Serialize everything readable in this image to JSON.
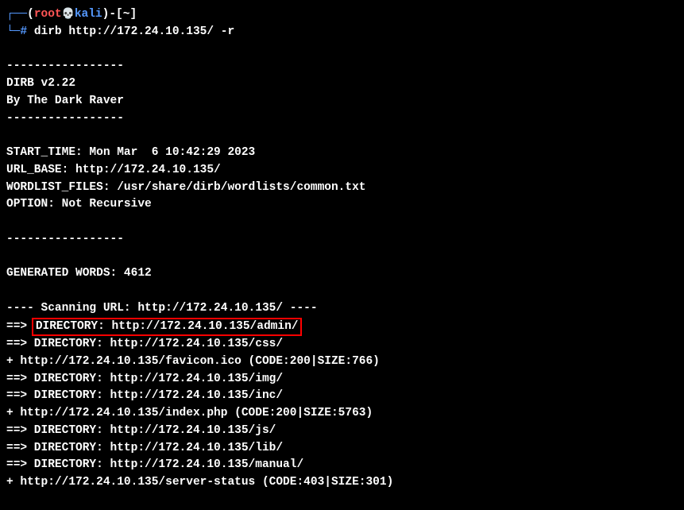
{
  "prompt": {
    "open_paren": "(",
    "user": "root",
    "skull": "💀",
    "host": "kali",
    "close_paren": ")",
    "dash": "-",
    "open_bracket": "[",
    "path": "~",
    "close_bracket": "]",
    "hash": "#",
    "corner_top": "┌──",
    "corner_bottom": "└─"
  },
  "command": "dirb http://172.24.10.135/ -r",
  "output": {
    "sep1": "-----------------",
    "version": "DIRB v2.22",
    "author": "By The Dark Raver",
    "sep2": "-----------------",
    "start_time": "START_TIME: Mon Mar  6 10:42:29 2023",
    "url_base": "URL_BASE: http://172.24.10.135/",
    "wordlist": "WORDLIST_FILES: /usr/share/dirb/wordlists/common.txt",
    "option": "OPTION: Not Recursive",
    "sep3": "-----------------",
    "generated": "GENERATED WORDS: 4612",
    "scanning": "---- Scanning URL: http://172.24.10.135/ ----",
    "prefix_admin": "==> ",
    "dir_admin": "DIRECTORY: http://172.24.10.135/admin/",
    "dir_css": "==> DIRECTORY: http://172.24.10.135/css/",
    "file_favicon": "+ http://172.24.10.135/favicon.ico (CODE:200|SIZE:766)",
    "dir_img": "==> DIRECTORY: http://172.24.10.135/img/",
    "dir_inc": "==> DIRECTORY: http://172.24.10.135/inc/",
    "file_index": "+ http://172.24.10.135/index.php (CODE:200|SIZE:5763)",
    "dir_js": "==> DIRECTORY: http://172.24.10.135/js/",
    "dir_lib": "==> DIRECTORY: http://172.24.10.135/lib/",
    "dir_manual": "==> DIRECTORY: http://172.24.10.135/manual/",
    "file_server_status": "+ http://172.24.10.135/server-status (CODE:403|SIZE:301)"
  }
}
